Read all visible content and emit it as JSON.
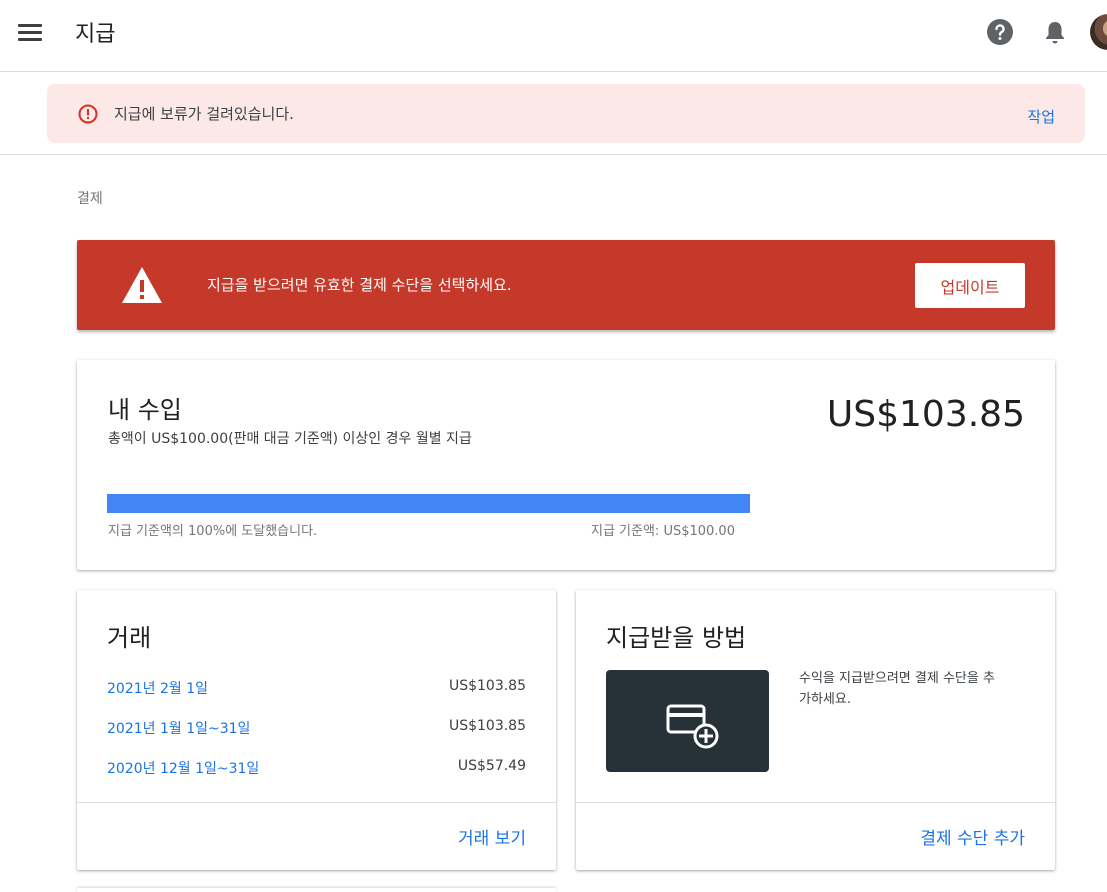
{
  "header": {
    "title": "지급",
    "menu_icon": "hamburger-menu-icon",
    "help_icon": "help-icon",
    "bell_icon": "notification-bell-icon"
  },
  "hold_banner": {
    "message": "지급에 보류가 걸려있습니다.",
    "action_label": "작업",
    "icon": "error-outline-icon"
  },
  "section_label": "결제",
  "alert": {
    "message": "지급을 받으려면 유효한 결제 수단을 선택하세요.",
    "button_label": "업데이트",
    "icon": "warning-triangle-icon",
    "color": "#c5392a"
  },
  "earnings": {
    "title": "내 수입",
    "subtitle": "총액이 US$100.00(판매 대금 기준액) 이상인 경우 월별 지급",
    "amount": "US$103.85",
    "progress_percent": 100,
    "progress_left": "지급 기준액의 100%에 도달했습니다.",
    "progress_right": "지급 기준액: US$100.00",
    "bar_color": "#4285f4"
  },
  "transactions": {
    "title": "거래",
    "rows": [
      {
        "date": "2021년 2월 1일",
        "amount": "US$103.85"
      },
      {
        "date": "2021년 1월 1일~31일",
        "amount": "US$103.85"
      },
      {
        "date": "2020년 12월 1일~31일",
        "amount": "US$57.49"
      }
    ],
    "link_label": "거래 보기"
  },
  "payment_method": {
    "title": "지급받을 방법",
    "description": "수익을 지급받으려면 결제 수단을 추가하세요.",
    "link_label": "결제 수단 추가",
    "icon": "add-card-icon"
  },
  "colors": {
    "link": "#1a73e8",
    "hold_bg": "#fce8e6"
  }
}
